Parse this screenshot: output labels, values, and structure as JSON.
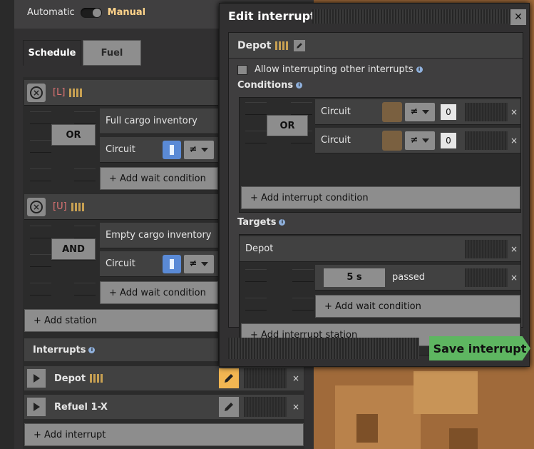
{
  "mode": {
    "automatic": "Automatic",
    "manual": "Manual"
  },
  "tabs": {
    "schedule": "Schedule",
    "fuel": "Fuel"
  },
  "schedule": {
    "stations": [
      {
        "name": "[L]",
        "logic": "OR",
        "conditions": [
          "Full cargo inventory",
          "Circuit"
        ],
        "add_wait": "+ Add wait condition"
      },
      {
        "name": "[U]",
        "logic": "AND",
        "conditions": [
          "Empty cargo inventory",
          "Circuit"
        ],
        "add_wait": "+ Add wait condition"
      }
    ],
    "add_station": "+ Add station",
    "neq": "≠"
  },
  "interrupts": {
    "title": "Interrupts",
    "items": [
      {
        "name": "Depot"
      },
      {
        "name": "Refuel 1-X"
      }
    ],
    "add_interrupt": "+ Add interrupt"
  },
  "dialog": {
    "title": "Edit interrupt",
    "interrupt_name": "Depot",
    "allow_label": "Allow interrupting other interrupts",
    "conditions_label": "Conditions",
    "logic": "OR",
    "conditions": [
      {
        "label": "Circuit",
        "op": "≠",
        "value": "0"
      },
      {
        "label": "Circuit",
        "op": "≠",
        "value": "0"
      }
    ],
    "add_condition": "+ Add interrupt condition",
    "targets_label": "Targets",
    "target_station": "Depot",
    "wait_time": "5 s",
    "wait_passed": "passed",
    "add_wait": "+ Add wait condition",
    "add_station": "+ Add interrupt station",
    "save": "Save interrupt"
  },
  "colors": {
    "accent_green": "#5eb661",
    "pencil_orange": "#f2b652",
    "station_red": "#e07474",
    "manual_yellow": "#ffd38a"
  }
}
